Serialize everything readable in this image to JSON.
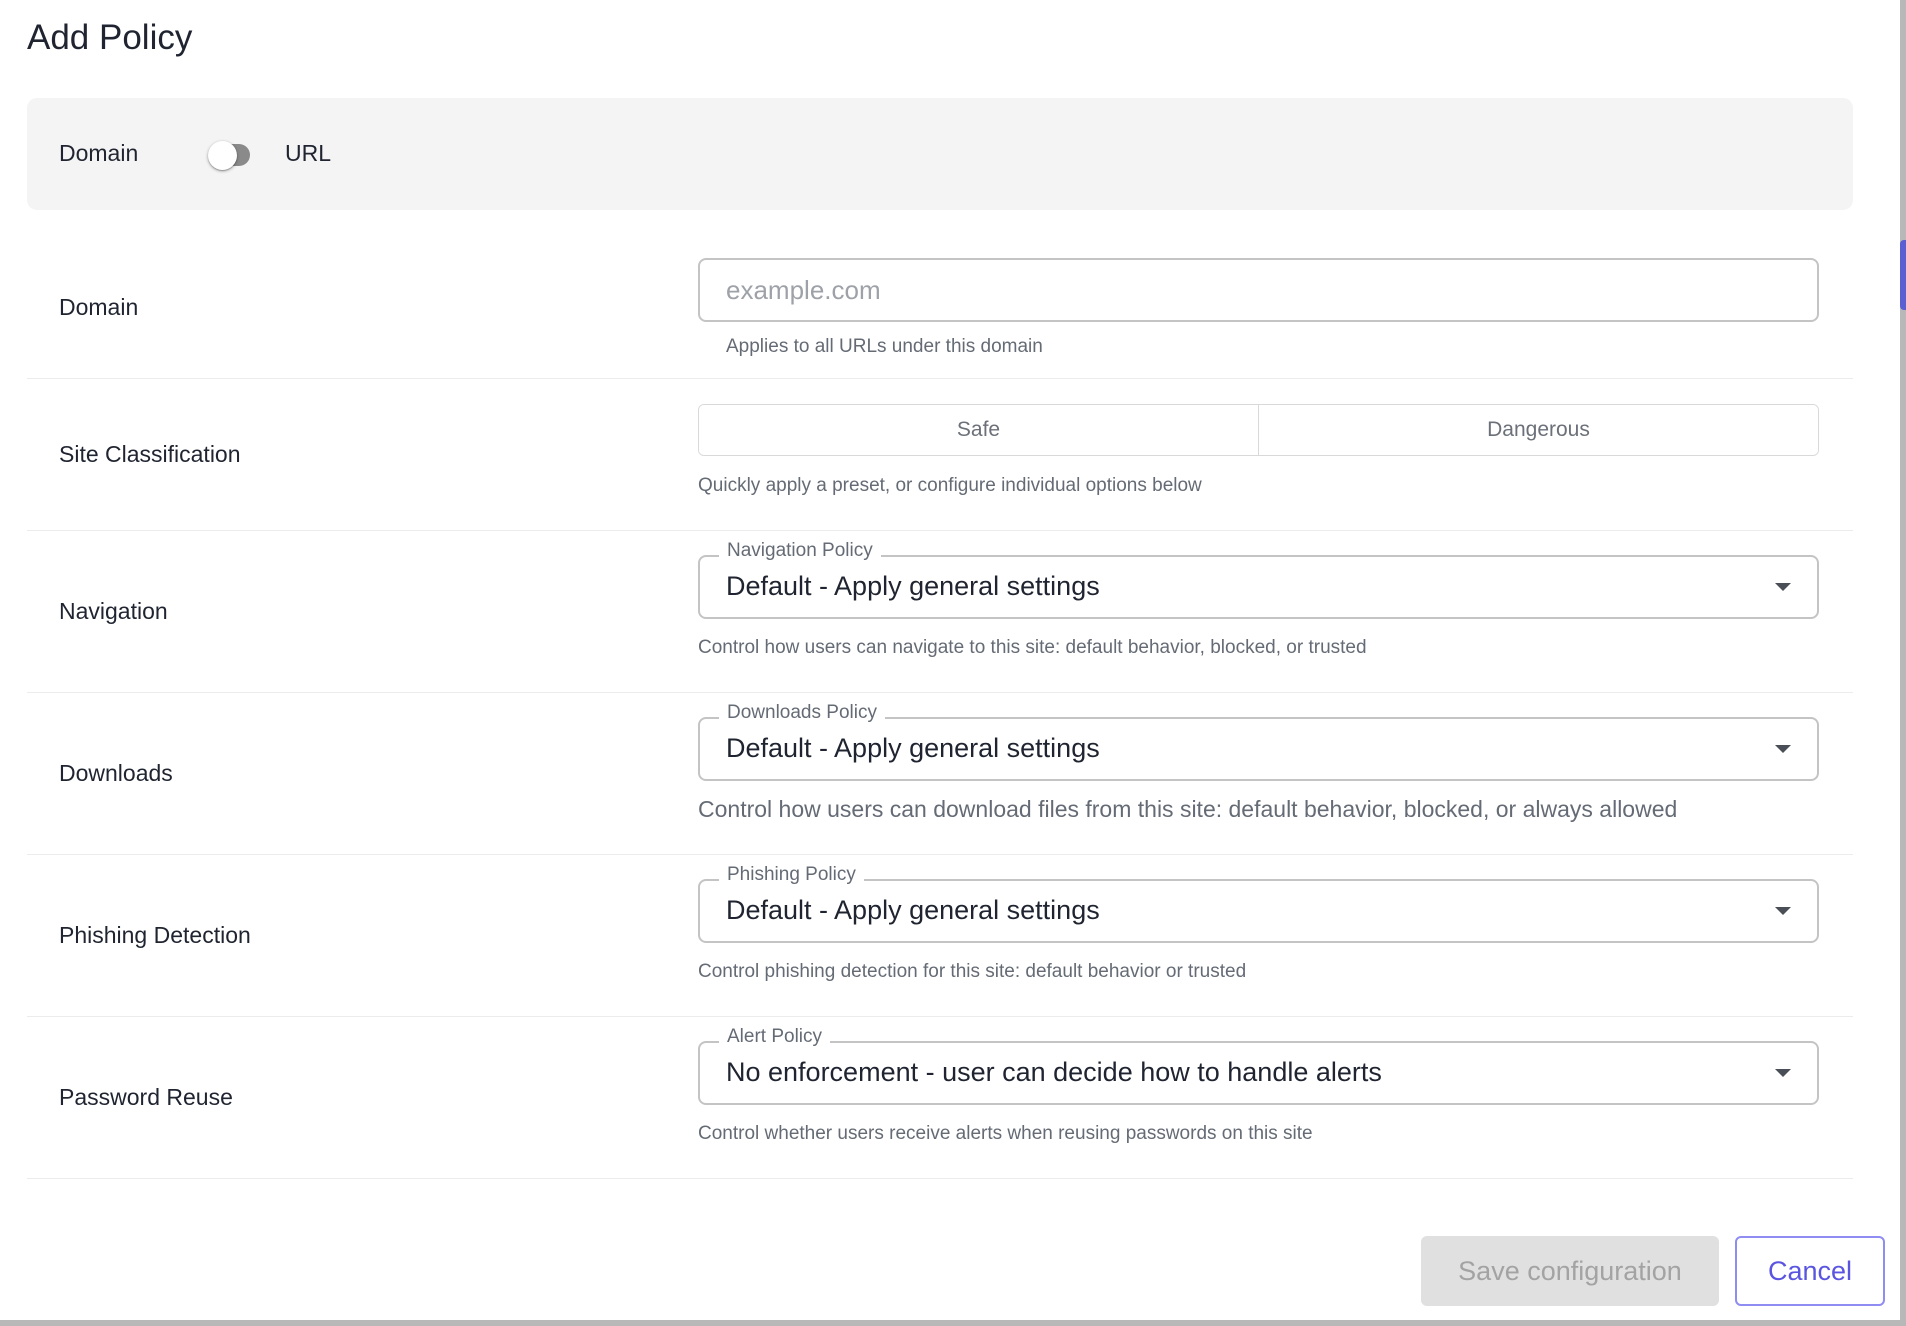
{
  "dialog": {
    "title": "Add Policy"
  },
  "match_type": {
    "left_label": "Domain",
    "right_label": "URL",
    "selected": "Domain"
  },
  "rows": {
    "domain": {
      "label": "Domain",
      "placeholder": "example.com",
      "value": "",
      "helper": "Applies to all URLs under this domain"
    },
    "classification": {
      "label": "Site Classification",
      "options": [
        "Safe",
        "Dangerous"
      ],
      "helper": "Quickly apply a preset, or configure individual options below"
    },
    "navigation": {
      "label": "Navigation",
      "select_label": "Navigation Policy",
      "value": "Default - Apply general settings",
      "helper": "Control how users can navigate to this site: default behavior, blocked, or trusted"
    },
    "downloads": {
      "label": "Downloads",
      "select_label": "Downloads Policy",
      "value": "Default - Apply general settings",
      "helper": "Control how users can download files from this site: default behavior, blocked, or always allowed"
    },
    "phishing": {
      "label": "Phishing Detection",
      "select_label": "Phishing Policy",
      "value": "Default - Apply general settings",
      "helper": "Control phishing detection for this site: default behavior or trusted"
    },
    "password_reuse": {
      "label": "Password Reuse",
      "select_label": "Alert Policy",
      "value": "No enforcement - user can decide how to handle alerts",
      "helper": "Control whether users receive alerts when reusing passwords on this site"
    }
  },
  "footer": {
    "save_label": "Save configuration",
    "cancel_label": "Cancel"
  },
  "colors": {
    "accent": "#5a55e0",
    "disabled_bg": "#e0e0e0",
    "panel_bg": "#f4f4f4"
  }
}
